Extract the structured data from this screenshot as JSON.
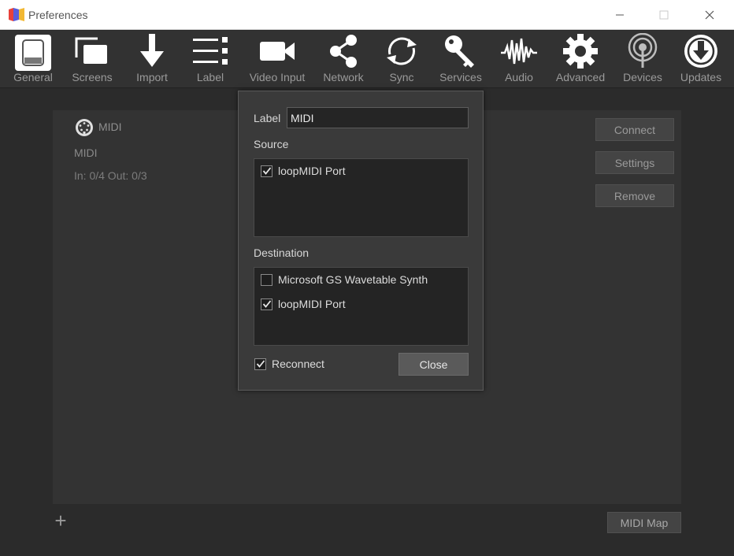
{
  "window": {
    "title": "Preferences"
  },
  "toolbar": {
    "items": [
      {
        "label": "General",
        "icon": "general-icon"
      },
      {
        "label": "Screens",
        "icon": "screens-icon"
      },
      {
        "label": "Import",
        "icon": "import-icon"
      },
      {
        "label": "Label",
        "icon": "label-icon"
      },
      {
        "label": "Video Input",
        "icon": "video-input-icon"
      },
      {
        "label": "Network",
        "icon": "network-icon"
      },
      {
        "label": "Sync",
        "icon": "sync-icon"
      },
      {
        "label": "Services",
        "icon": "services-icon"
      },
      {
        "label": "Audio",
        "icon": "audio-icon"
      },
      {
        "label": "Advanced",
        "icon": "advanced-icon"
      },
      {
        "label": "Devices",
        "icon": "devices-icon"
      },
      {
        "label": "Updates",
        "icon": "updates-icon"
      }
    ],
    "active": "General"
  },
  "device": {
    "name": "MIDI",
    "type": "MIDI",
    "io": "In: 0/4 Out: 0/3",
    "buttons": {
      "connect": "Connect",
      "settings": "Settings",
      "remove": "Remove"
    }
  },
  "footer": {
    "add": "+",
    "midi_map": "MIDI Map"
  },
  "dialog": {
    "label_caption": "Label",
    "label_value": "MIDI",
    "source_caption": "Source",
    "source_items": [
      {
        "name": "loopMIDI Port",
        "checked": true
      }
    ],
    "destination_caption": "Destination",
    "destination_items": [
      {
        "name": "Microsoft GS Wavetable Synth",
        "checked": false
      },
      {
        "name": "loopMIDI Port",
        "checked": true
      }
    ],
    "reconnect_label": "Reconnect",
    "reconnect_checked": true,
    "close_label": "Close"
  },
  "colors": {
    "background": "#2b2b2b",
    "panel": "#333333",
    "dialog": "#3a3a3a",
    "toolbar": "#323232"
  }
}
